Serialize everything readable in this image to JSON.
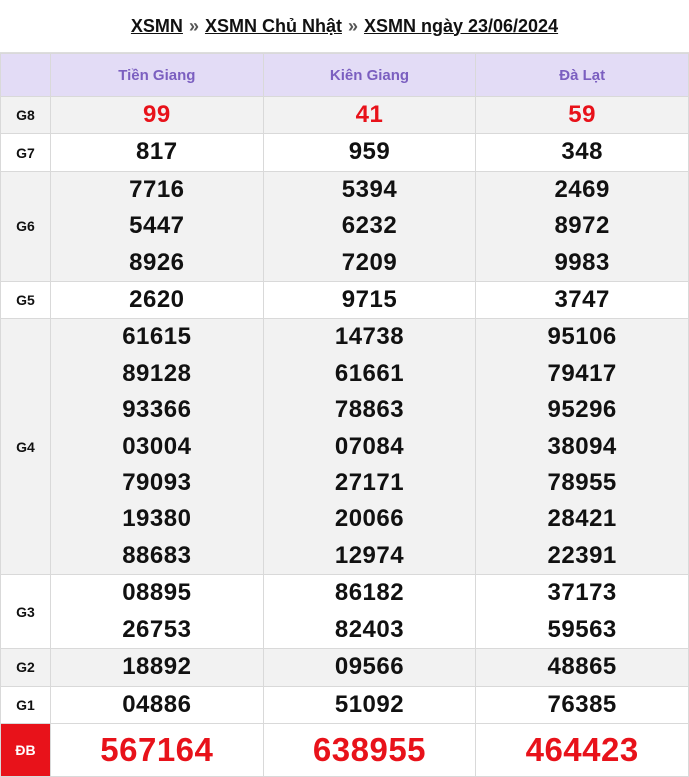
{
  "breadcrumb": {
    "items": [
      "XSMN",
      "XSMN Chủ Nhật",
      "XSMN ngày 23/06/2024"
    ],
    "separator": "»"
  },
  "colors": {
    "header_bg": "#e3dcf6",
    "header_text": "#7b5fc0",
    "highlight_red": "#e8121a",
    "alt_row_bg": "#f2f2f2"
  },
  "provinces": [
    "Tiền Giang",
    "Kiên Giang",
    "Đà Lạt"
  ],
  "prizes": [
    {
      "label": "G8",
      "style": "red",
      "values": [
        [
          "99"
        ],
        [
          "41"
        ],
        [
          "59"
        ]
      ]
    },
    {
      "label": "G7",
      "style": "normal",
      "values": [
        [
          "817"
        ],
        [
          "959"
        ],
        [
          "348"
        ]
      ]
    },
    {
      "label": "G6",
      "style": "normal",
      "values": [
        [
          "7716",
          "5447",
          "8926"
        ],
        [
          "5394",
          "6232",
          "7209"
        ],
        [
          "2469",
          "8972",
          "9983"
        ]
      ]
    },
    {
      "label": "G5",
      "style": "normal",
      "values": [
        [
          "2620"
        ],
        [
          "9715"
        ],
        [
          "3747"
        ]
      ]
    },
    {
      "label": "G4",
      "style": "normal",
      "values": [
        [
          "61615",
          "89128",
          "93366",
          "03004",
          "79093",
          "19380",
          "88683"
        ],
        [
          "14738",
          "61661",
          "78863",
          "07084",
          "27171",
          "20066",
          "12974"
        ],
        [
          "95106",
          "79417",
          "95296",
          "38094",
          "78955",
          "28421",
          "22391"
        ]
      ]
    },
    {
      "label": "G3",
      "style": "normal",
      "values": [
        [
          "08895",
          "26753"
        ],
        [
          "86182",
          "82403"
        ],
        [
          "37173",
          "59563"
        ]
      ]
    },
    {
      "label": "G2",
      "style": "normal",
      "values": [
        [
          "18892"
        ],
        [
          "09566"
        ],
        [
          "48865"
        ]
      ]
    },
    {
      "label": "G1",
      "style": "normal",
      "values": [
        [
          "04886"
        ],
        [
          "51092"
        ],
        [
          "76385"
        ]
      ]
    },
    {
      "label": "ĐB",
      "style": "big",
      "values": [
        [
          "567164"
        ],
        [
          "638955"
        ],
        [
          "464423"
        ]
      ]
    }
  ]
}
